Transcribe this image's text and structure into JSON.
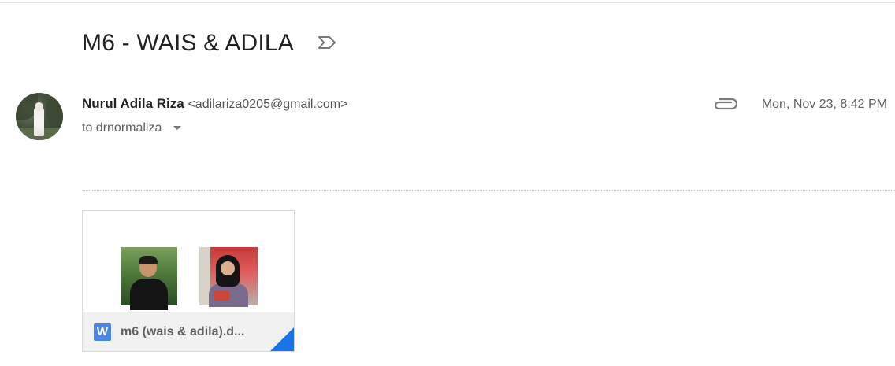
{
  "email": {
    "subject": "M6 - WAIS & ADILA",
    "sender": {
      "name": "Nurul Adila Riza",
      "email": "<adilariza0205@gmail.com>"
    },
    "recipient": "to drnormaliza",
    "date": "Mon, Nov 23, 8:42 PM"
  },
  "icons": {
    "importance": "importance-marker-icon",
    "attachment": "paperclip-icon",
    "recipient_toggle": "caret-down-icon",
    "file_type": "word-icon",
    "file_type_letter": "W"
  },
  "attachment": {
    "file_name": "m6 (wais & adila).d...",
    "accent_color": "#1a73e8"
  },
  "colors": {
    "word": "#4a86e8",
    "text": "#222222",
    "muted": "#5f5f5f"
  }
}
